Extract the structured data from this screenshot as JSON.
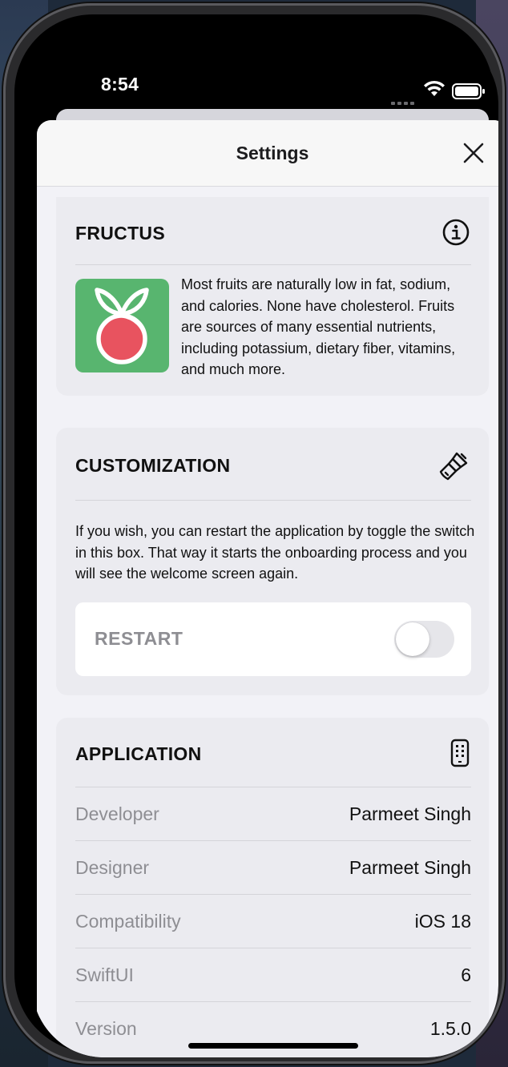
{
  "status_bar": {
    "time": "8:54"
  },
  "navbar": {
    "title": "Settings",
    "close_icon": "xmark-icon"
  },
  "about": {
    "title": "FRUCTUS",
    "icon": "info-circle-icon",
    "logo_icon": "fruit-logo-icon",
    "logo_color": "#58b56f",
    "text": "Most fruits are naturally low in fat, sodium, and calories. None have cholesterol. Fruits are sources of many essential nutrients, including potassium, dietary fiber, vitamins, and much more."
  },
  "customization": {
    "title": "CUSTOMIZATION",
    "icon": "paintbrush-icon",
    "text": "If you wish, you can restart the application by toggle the switch in this box. That way it starts the onboarding process and you will see the welcome screen again.",
    "restart_label": "RESTART",
    "restart_toggle_on": false
  },
  "application": {
    "title": "APPLICATION",
    "icon": "iphone-icon",
    "rows": [
      {
        "label": "Developer",
        "value": "Parmeet Singh"
      },
      {
        "label": "Designer",
        "value": "Parmeet Singh"
      },
      {
        "label": "Compatibility",
        "value": "iOS 18"
      },
      {
        "label": "SwiftUI",
        "value": "6"
      },
      {
        "label": "Version",
        "value": "1.5.0"
      }
    ]
  }
}
